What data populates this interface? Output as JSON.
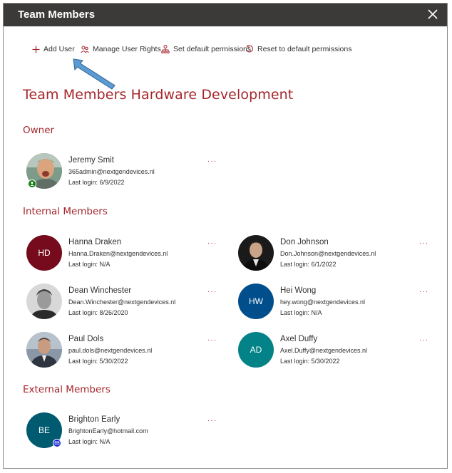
{
  "dialog": {
    "title": "Team Members"
  },
  "toolbar": {
    "add_user": "Add User",
    "manage_rights": "Manage User Rights",
    "set_default": "Set default permissions",
    "reset_default": "Reset to default permissions"
  },
  "page": {
    "title": "Team Members Hardware Development"
  },
  "sections": {
    "owner": "Owner",
    "internal": "Internal Members",
    "external": "External Members"
  },
  "owner": {
    "name": "Jeremy Smit",
    "email": "365admin@nextgendevices.nl",
    "login": "Last login: 6/9/2022",
    "badge_color": "#107c10"
  },
  "internal_members": [
    {
      "name": "Hanna Draken",
      "email": "Hanna.Draken@nextgendevices.nl",
      "login": "Last login: N/A",
      "initials": "HD",
      "color": "#750b1c"
    },
    {
      "name": "Don Johnson",
      "email": "Don.Johnson@nextgendevices.nl",
      "login": "Last login: 6/1/2022"
    },
    {
      "name": "Dean Winchester",
      "email": "Dean.Winchester@nextgendevices.nl",
      "login": "Last login: 8/26/2020"
    },
    {
      "name": "Hei Wong",
      "email": "hey.wong@nextgendevices.nl",
      "login": "Last login: N/A",
      "initials": "HW",
      "color": "#004e8c"
    },
    {
      "name": "Paul Dols",
      "email": "paul.dols@nextgendevices.nl",
      "login": "Last login: 5/30/2022"
    },
    {
      "name": "Axel Duffy",
      "email": "Axel.Duffy@nextgendevices.nl",
      "login": "Last login: 5/30/2022",
      "initials": "AD",
      "color": "#038387"
    }
  ],
  "external_members": [
    {
      "name": "Brighton Early",
      "email": "BrightonEarly@hotmail.com",
      "login": "Last login: N/A",
      "initials": "BE",
      "color": "#005b70",
      "badge_color": "#0f1fd6"
    }
  ],
  "more_label": "···",
  "colors": {
    "accent": "#a4262c",
    "titlebar": "#3b3a39"
  }
}
